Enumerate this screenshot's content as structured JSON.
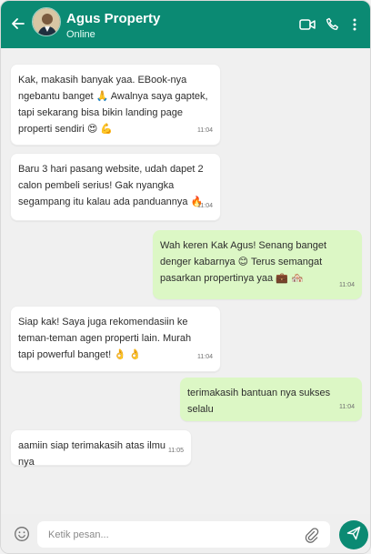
{
  "header": {
    "contact_name": "Agus Property",
    "status": "Online",
    "icons": [
      "back-arrow-icon",
      "video-call-icon",
      "phone-call-icon",
      "more-vertical-icon"
    ],
    "color": "#0b8a73"
  },
  "messages": [
    {
      "direction": "incoming",
      "text": "Kak, makasih banyak yaa. EBook-nya\nngebantu banget 🙏 Awalnya saya gaptek,\ntapi sekarang bisa bikin landing page\nproperti sendiri 😍 💪",
      "time": "11:04"
    },
    {
      "direction": "incoming",
      "text": "Baru 3 hari pasang website, udah dapet 2\ncalon pembeli serius! Gak nyangka\nsegampang itu kalau ada panduannya 🔥",
      "time": "11:04"
    },
    {
      "direction": "outgoing",
      "text": "Wah keren Kak Agus! Senang banget\ndenger kabarnya 😊 Terus semangat\npasarkan propertinya yaa 💼 🏘️",
      "time": "11:04"
    },
    {
      "direction": "incoming",
      "text": "Siap kak! Saya juga rekomendasiin ke\nteman-teman agen properti lain. Murah\ntapi powerful banget! 👌 👌",
      "time": "11:04"
    },
    {
      "direction": "outgoing",
      "text": "terimakasih bantuan nya sukses selalu",
      "time": "11:04"
    },
    {
      "direction": "incoming",
      "text": "aamiin siap terimakasih atas ilmu nya",
      "time": "11:05"
    }
  ],
  "composer": {
    "placeholder": "Ketik pesan...",
    "icons": [
      "emoji-icon",
      "attachment-icon",
      "send-icon"
    ]
  }
}
